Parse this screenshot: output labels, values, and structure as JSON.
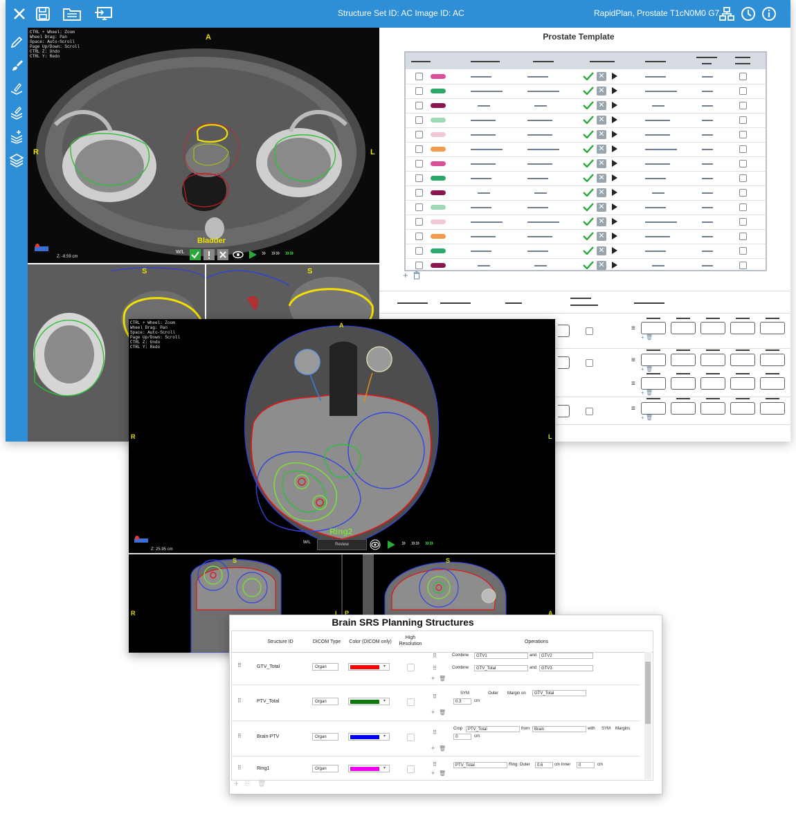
{
  "main_window": {
    "title": "Structure Set ID: AC  Image ID: AC",
    "plan": "RapidPlan, Prostate T1cN0M0 G7",
    "toolbar_icons": [
      "close-icon",
      "save-icon",
      "folder-icon",
      "monitor-icon",
      "network-icon",
      "clock-icon",
      "info-icon"
    ],
    "left_tools": [
      "pencil-icon",
      "brush-icon",
      "layer-edit-icon",
      "layer-stack-icon",
      "layer-add-icon",
      "layers-icon"
    ],
    "axial_view": {
      "hint_lines": [
        "CTRL + Wheel: Zoom",
        "Wheel Drag: Pan",
        "Space: Auto-Scroll",
        "Page Up/Down: Scroll",
        "CTRL Z: Undo",
        "CTRL Y: Redo"
      ],
      "dir_top": "A",
      "dir_left": "R",
      "dir_right": "L",
      "z_label": "Z: -8.59 cm",
      "structure_label": "Bladder",
      "w_label": "W/L"
    },
    "sub_views": {
      "dir_s": "S"
    },
    "template": {
      "title": "Prostate Template",
      "pill_colors": [
        "#d9509a",
        "#2ea86a",
        "#8b1452",
        "#9fd8b4",
        "#f2c8d8",
        "#f29a4e",
        "#d9509a",
        "#2ea86a",
        "#8b1452",
        "#9fd8b4",
        "#f2c8d8",
        "#f29a4e",
        "#2ea86a",
        "#8b1452"
      ]
    }
  },
  "brain_viewer": {
    "hint_lines": [
      "CTRL + Wheel: Zoom",
      "Wheel Drag: Pan",
      "Space: Auto-Scroll",
      "Page Up/Down: Scroll",
      "CTRL Z: Undo",
      "CTRL Y: Redo"
    ],
    "dir_top": "A",
    "dir_left": "R",
    "dir_right": "L",
    "z_label": "Z: 25.95 cm",
    "structure_label": "Ring2",
    "w_label": "W/L",
    "review_label": "Review",
    "sub_dirs": {
      "s1": "S",
      "s2": "S",
      "r": "R",
      "l": "L",
      "p": "P",
      "a": "A"
    }
  },
  "srs_dialog": {
    "title": "Brain SRS Planning Structures",
    "headers": {
      "structure_id": "Structure ID",
      "dicom_type": "DICOM Type",
      "color": "Color (DICOM only)",
      "high_res_1": "High",
      "high_res_2": "Resolution",
      "operations": "Operations"
    },
    "rows": [
      {
        "id": "GTV_Total",
        "type": "Organ",
        "color": "#ff0000"
      },
      {
        "id": "PTV_Total",
        "type": "Organ",
        "color": "#0a7a0a"
      },
      {
        "id": "Brain-PTV",
        "type": "Organ",
        "color": "#0000ee"
      },
      {
        "id": "Ring1",
        "type": "Organ",
        "color": "#ee00ee"
      }
    ],
    "ops": {
      "combine": "Combine",
      "and": "and",
      "gtv1": "GTV1",
      "gtv2": "GTV2",
      "gtv_total": "GTV_Total",
      "gtv3": "GTV3",
      "sym": "SYM",
      "outer": "Outer",
      "margin_on": "Margin on",
      "margin_target": "GTV_Total",
      "margin_value": "0.3",
      "cm": "cm",
      "crop": "Crop",
      "crop_target": "PTV_Total",
      "from": "from",
      "crop_from": "Brain",
      "with": "with",
      "sym2": "SYM",
      "margins": "Margins",
      "crop_value": "0",
      "ring_target": "PTV_Total",
      "ring_outer": "Ring: Outer",
      "ring_outer_value": "0.6",
      "cm_inner": "cm  Inner",
      "ring_inner_value": "0"
    }
  }
}
